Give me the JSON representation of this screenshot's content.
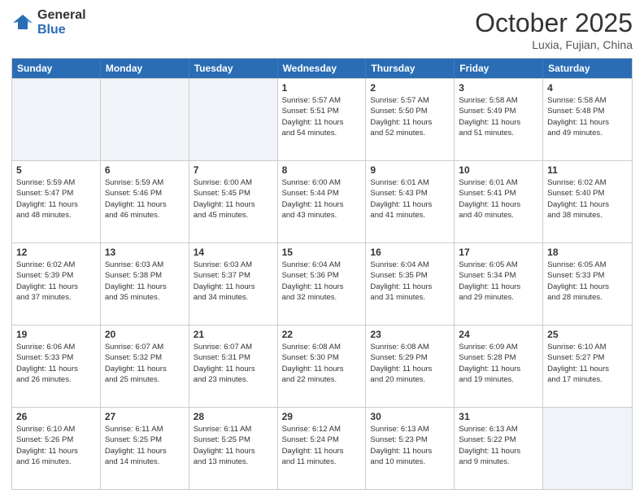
{
  "header": {
    "logo_line1": "General",
    "logo_line2": "Blue",
    "month": "October 2025",
    "location": "Luxia, Fujian, China"
  },
  "weekdays": [
    "Sunday",
    "Monday",
    "Tuesday",
    "Wednesday",
    "Thursday",
    "Friday",
    "Saturday"
  ],
  "weeks": [
    [
      {
        "day": "",
        "info": ""
      },
      {
        "day": "",
        "info": ""
      },
      {
        "day": "",
        "info": ""
      },
      {
        "day": "1",
        "info": "Sunrise: 5:57 AM\nSunset: 5:51 PM\nDaylight: 11 hours\nand 54 minutes."
      },
      {
        "day": "2",
        "info": "Sunrise: 5:57 AM\nSunset: 5:50 PM\nDaylight: 11 hours\nand 52 minutes."
      },
      {
        "day": "3",
        "info": "Sunrise: 5:58 AM\nSunset: 5:49 PM\nDaylight: 11 hours\nand 51 minutes."
      },
      {
        "day": "4",
        "info": "Sunrise: 5:58 AM\nSunset: 5:48 PM\nDaylight: 11 hours\nand 49 minutes."
      }
    ],
    [
      {
        "day": "5",
        "info": "Sunrise: 5:59 AM\nSunset: 5:47 PM\nDaylight: 11 hours\nand 48 minutes."
      },
      {
        "day": "6",
        "info": "Sunrise: 5:59 AM\nSunset: 5:46 PM\nDaylight: 11 hours\nand 46 minutes."
      },
      {
        "day": "7",
        "info": "Sunrise: 6:00 AM\nSunset: 5:45 PM\nDaylight: 11 hours\nand 45 minutes."
      },
      {
        "day": "8",
        "info": "Sunrise: 6:00 AM\nSunset: 5:44 PM\nDaylight: 11 hours\nand 43 minutes."
      },
      {
        "day": "9",
        "info": "Sunrise: 6:01 AM\nSunset: 5:43 PM\nDaylight: 11 hours\nand 41 minutes."
      },
      {
        "day": "10",
        "info": "Sunrise: 6:01 AM\nSunset: 5:41 PM\nDaylight: 11 hours\nand 40 minutes."
      },
      {
        "day": "11",
        "info": "Sunrise: 6:02 AM\nSunset: 5:40 PM\nDaylight: 11 hours\nand 38 minutes."
      }
    ],
    [
      {
        "day": "12",
        "info": "Sunrise: 6:02 AM\nSunset: 5:39 PM\nDaylight: 11 hours\nand 37 minutes."
      },
      {
        "day": "13",
        "info": "Sunrise: 6:03 AM\nSunset: 5:38 PM\nDaylight: 11 hours\nand 35 minutes."
      },
      {
        "day": "14",
        "info": "Sunrise: 6:03 AM\nSunset: 5:37 PM\nDaylight: 11 hours\nand 34 minutes."
      },
      {
        "day": "15",
        "info": "Sunrise: 6:04 AM\nSunset: 5:36 PM\nDaylight: 11 hours\nand 32 minutes."
      },
      {
        "day": "16",
        "info": "Sunrise: 6:04 AM\nSunset: 5:35 PM\nDaylight: 11 hours\nand 31 minutes."
      },
      {
        "day": "17",
        "info": "Sunrise: 6:05 AM\nSunset: 5:34 PM\nDaylight: 11 hours\nand 29 minutes."
      },
      {
        "day": "18",
        "info": "Sunrise: 6:05 AM\nSunset: 5:33 PM\nDaylight: 11 hours\nand 28 minutes."
      }
    ],
    [
      {
        "day": "19",
        "info": "Sunrise: 6:06 AM\nSunset: 5:33 PM\nDaylight: 11 hours\nand 26 minutes."
      },
      {
        "day": "20",
        "info": "Sunrise: 6:07 AM\nSunset: 5:32 PM\nDaylight: 11 hours\nand 25 minutes."
      },
      {
        "day": "21",
        "info": "Sunrise: 6:07 AM\nSunset: 5:31 PM\nDaylight: 11 hours\nand 23 minutes."
      },
      {
        "day": "22",
        "info": "Sunrise: 6:08 AM\nSunset: 5:30 PM\nDaylight: 11 hours\nand 22 minutes."
      },
      {
        "day": "23",
        "info": "Sunrise: 6:08 AM\nSunset: 5:29 PM\nDaylight: 11 hours\nand 20 minutes."
      },
      {
        "day": "24",
        "info": "Sunrise: 6:09 AM\nSunset: 5:28 PM\nDaylight: 11 hours\nand 19 minutes."
      },
      {
        "day": "25",
        "info": "Sunrise: 6:10 AM\nSunset: 5:27 PM\nDaylight: 11 hours\nand 17 minutes."
      }
    ],
    [
      {
        "day": "26",
        "info": "Sunrise: 6:10 AM\nSunset: 5:26 PM\nDaylight: 11 hours\nand 16 minutes."
      },
      {
        "day": "27",
        "info": "Sunrise: 6:11 AM\nSunset: 5:25 PM\nDaylight: 11 hours\nand 14 minutes."
      },
      {
        "day": "28",
        "info": "Sunrise: 6:11 AM\nSunset: 5:25 PM\nDaylight: 11 hours\nand 13 minutes."
      },
      {
        "day": "29",
        "info": "Sunrise: 6:12 AM\nSunset: 5:24 PM\nDaylight: 11 hours\nand 11 minutes."
      },
      {
        "day": "30",
        "info": "Sunrise: 6:13 AM\nSunset: 5:23 PM\nDaylight: 11 hours\nand 10 minutes."
      },
      {
        "day": "31",
        "info": "Sunrise: 6:13 AM\nSunset: 5:22 PM\nDaylight: 11 hours\nand 9 minutes."
      },
      {
        "day": "",
        "info": ""
      }
    ]
  ]
}
